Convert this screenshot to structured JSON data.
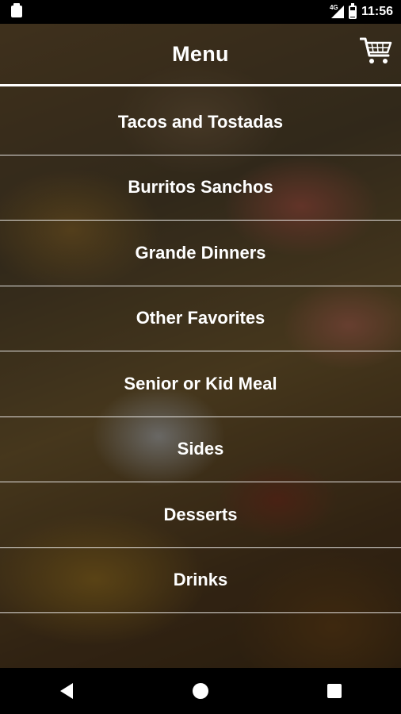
{
  "status_bar": {
    "time": "11:56",
    "network": "4G"
  },
  "header": {
    "title": "Menu"
  },
  "menu": {
    "items": [
      {
        "label": "Tacos and Tostadas"
      },
      {
        "label": "Burritos Sanchos"
      },
      {
        "label": "Grande Dinners"
      },
      {
        "label": "Other Favorites"
      },
      {
        "label": "Senior or Kid Meal"
      },
      {
        "label": "Sides"
      },
      {
        "label": "Desserts"
      },
      {
        "label": "Drinks"
      }
    ]
  },
  "icons": {
    "cart": "shopping-cart-icon",
    "back": "back-triangle-icon",
    "home": "home-circle-icon",
    "recents": "recents-square-icon"
  }
}
